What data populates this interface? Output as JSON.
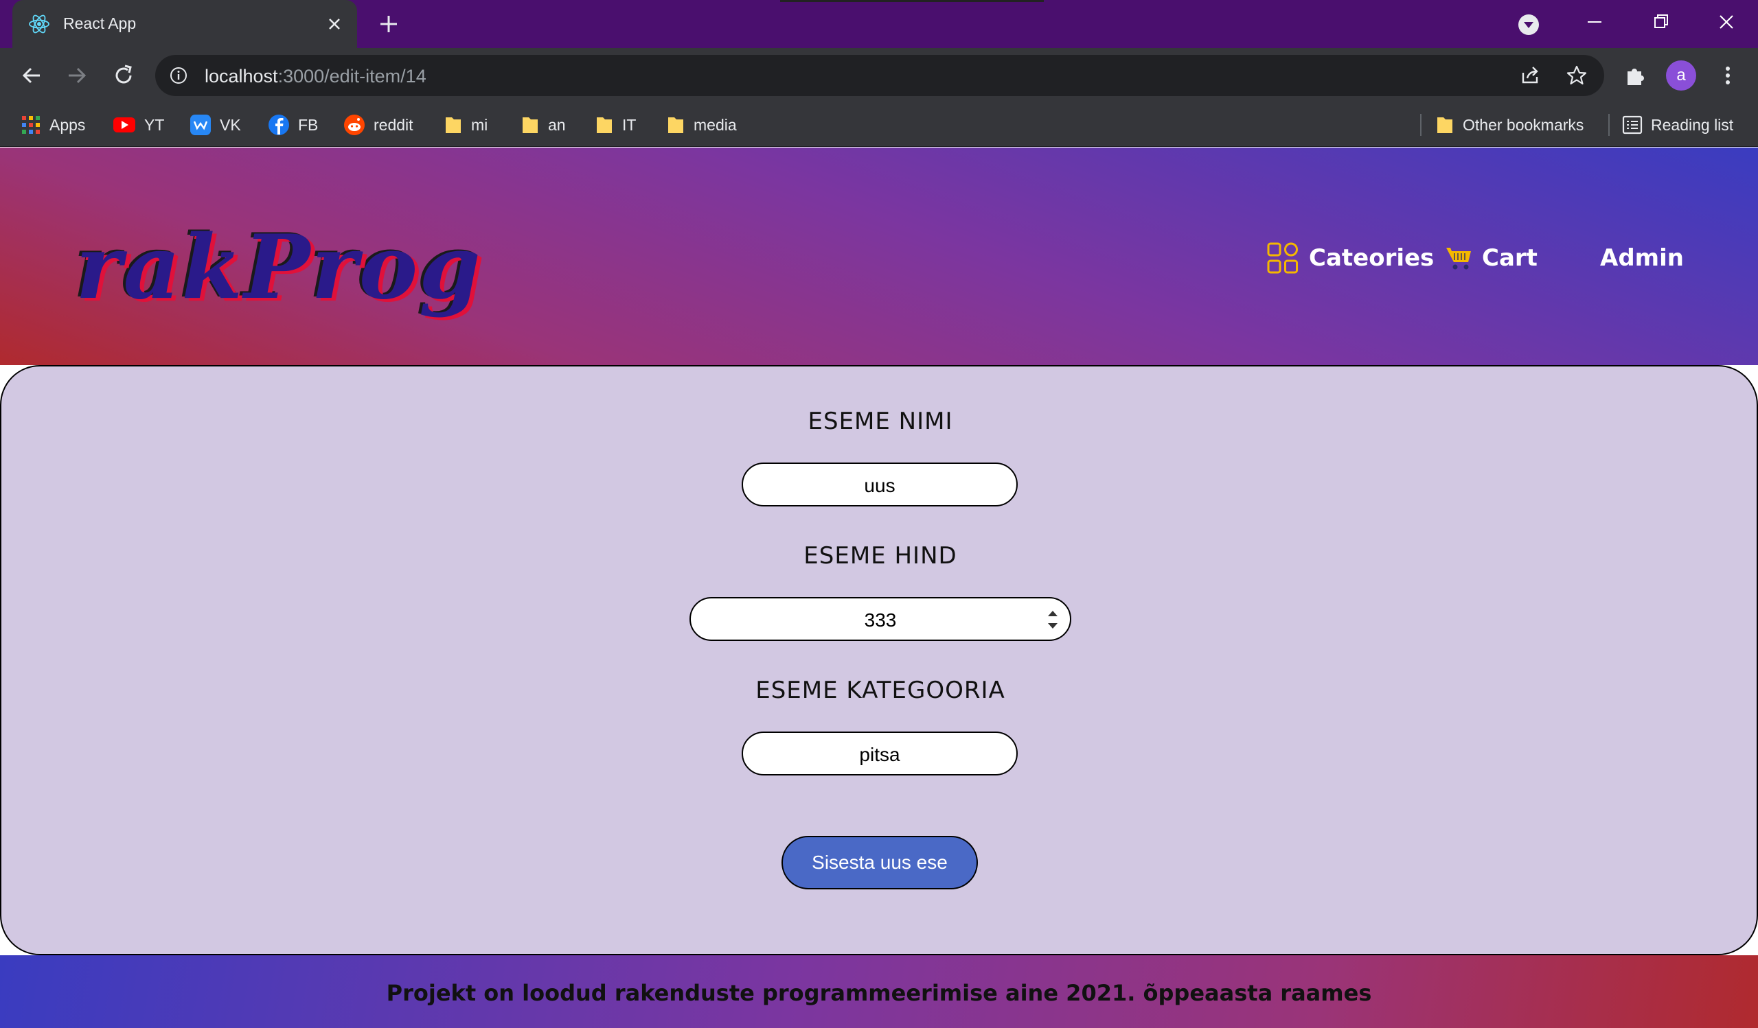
{
  "browser": {
    "tab_title": "React App",
    "url_host": "localhost",
    "url_path": ":3000/edit-item/14",
    "profile_initial": "a",
    "bookmarks": [
      {
        "label": "Apps",
        "icon": "apps-grid-icon"
      },
      {
        "label": "YT",
        "icon": "youtube-icon"
      },
      {
        "label": "VK",
        "icon": "vk-icon"
      },
      {
        "label": "FB",
        "icon": "facebook-icon"
      },
      {
        "label": "reddit",
        "icon": "reddit-icon"
      },
      {
        "label": "mi",
        "icon": "folder-icon"
      },
      {
        "label": "an",
        "icon": "folder-icon"
      },
      {
        "label": "IT",
        "icon": "folder-icon"
      },
      {
        "label": "media",
        "icon": "folder-icon"
      }
    ],
    "other_bookmarks": "Other bookmarks",
    "reading_list": "Reading list"
  },
  "header": {
    "logo": "rakProg",
    "nav": {
      "categories": "Cateories",
      "cart": "Cart",
      "admin": "Admin"
    }
  },
  "form": {
    "name_label": "ESEME NIMI",
    "name_value": "uus",
    "price_label": "ESEME HIND",
    "price_value": "333",
    "category_label": "ESEME KATEGOORIA",
    "category_value": "pitsa",
    "submit_label": "Sisesta uus ese"
  },
  "footer": {
    "text": "Projekt on loodud rakenduste programmeerimise aine 2021. õppeaasta raames"
  },
  "colors": {
    "accent_nav_icon": "#f5b800",
    "submit_button": "#4a69c6",
    "panel_bg": "#d2c8e2"
  }
}
